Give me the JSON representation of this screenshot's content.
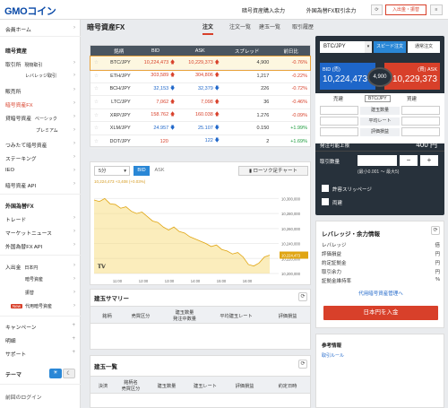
{
  "header": {
    "logo": "GMOコイン",
    "link1": "暗号資産購入余力",
    "link2": "外国為替FX取引余力",
    "signup_label": "入出金・振替"
  },
  "sidebar": {
    "items": [
      {
        "label": "会員ホーム"
      },
      {
        "label": "暗号資産"
      },
      {
        "label": "取引所"
      },
      {
        "label": "現物取引"
      },
      {
        "label": "レバレッジ取引"
      },
      {
        "label": "販売所"
      },
      {
        "label": "暗号資産FX"
      },
      {
        "label": "貸暗号資産"
      },
      {
        "label": "ベーシック"
      },
      {
        "label": "プレミアム"
      },
      {
        "label": "つみたて暗号資産"
      },
      {
        "label": "ステーキング"
      },
      {
        "label": "IEO"
      },
      {
        "label": "暗号資産 API"
      },
      {
        "label": "外国為替FX"
      },
      {
        "label": "トレード"
      },
      {
        "label": "マーケットニュース"
      },
      {
        "label": "外国為替FX API"
      },
      {
        "label": "入出金"
      },
      {
        "label": "日本円"
      },
      {
        "label": "暗号資産"
      },
      {
        "label": "振替"
      },
      {
        "label": "代用暗号資産"
      },
      {
        "label": "キャンペーン"
      },
      {
        "label": "明細"
      },
      {
        "label": "サポート"
      }
    ],
    "new_badge": "New",
    "theme_label": "テーマ",
    "last_login": "前回のログイン"
  },
  "main": {
    "title": "暗号資産FX",
    "tabs": [
      "注文",
      "注文一覧",
      "建玉一覧",
      "取引履歴"
    ],
    "rates": {
      "columns": [
        "銘柄",
        "BID",
        "ASK",
        "スプレッド",
        "前日比"
      ],
      "rows": [
        {
          "symbol": "BTC/JPY",
          "bid": "10,224,473",
          "ask": "10,229,373",
          "bid_dir": "up",
          "ask_dir": "up",
          "spread": "4,900",
          "chg": "-0.76%"
        },
        {
          "symbol": "ETH/JPY",
          "bid": "303,589",
          "ask": "304,806",
          "bid_dir": "up",
          "ask_dir": "up",
          "spread": "1,217",
          "chg": "-0.22%"
        },
        {
          "symbol": "BCH/JPY",
          "bid": "32,153",
          "ask": "32,379",
          "bid_dir": "down",
          "ask_dir": "down",
          "spread": "226",
          "chg": "-0.72%"
        },
        {
          "symbol": "LTC/JPY",
          "bid": "7,062",
          "ask": "7,098",
          "bid_dir": "up",
          "ask_dir": "up",
          "spread": "36",
          "chg": "-0.46%"
        },
        {
          "symbol": "XRP/JPY",
          "bid": "158.762",
          "ask": "160.038",
          "bid_dir": "up",
          "ask_dir": "up",
          "spread": "1.276",
          "chg": "-0.09%"
        },
        {
          "symbol": "XLM/JPY",
          "bid": "24.957",
          "ask": "25.107",
          "bid_dir": "down",
          "ask_dir": "down",
          "spread": "0.150",
          "chg": "+1.99%"
        },
        {
          "symbol": "DOT/JPY",
          "bid": "120",
          "ask": "122",
          "bid_dir": "none",
          "ask_dir": "down",
          "spread": "2",
          "chg": "+1.69%"
        }
      ]
    },
    "chart": {
      "interval": "5分",
      "bid_btn": "BID",
      "ask_btn": "ASK",
      "chart_btn": "ローソク足チャート",
      "ohlc": "10,224,473 +3,408 (+0.03%)",
      "price_tag": "10,224,473"
    },
    "positions_summary": {
      "title": "建玉サマリー",
      "columns": [
        "銘柄",
        "売買区分",
        "建玉数量\n発注中数量",
        "平均建玉レート",
        "評価損益"
      ]
    },
    "positions_list": {
      "title": "建玉一覧",
      "columns": [
        "決済",
        "銘柄名\n売買区分",
        "建玉数量",
        "建玉レート",
        "評価損益",
        "約定日時"
      ]
    }
  },
  "chart_data": {
    "type": "area",
    "x_ticks": [
      "11:00",
      "12:00",
      "13:00",
      "14:00",
      "15:00",
      "16:00"
    ],
    "y_ticks": [
      "10,300,000",
      "10,280,000",
      "10,260,000",
      "10,240,000",
      "10,220,000",
      "10,200,000"
    ],
    "ylim": [
      10200000,
      10310000
    ],
    "values": [
      10298000,
      10296000,
      10300000,
      10293000,
      10292000,
      10287000,
      10289000,
      10283000,
      10280000,
      10282000,
      10276000,
      10270000,
      10268000,
      10262000,
      10258000,
      10262000,
      10256000,
      10254000,
      10249000,
      10246000,
      10243000,
      10240000,
      10236000,
      10238000,
      10232000,
      10230000,
      10226000,
      10228000,
      10222000,
      10212000,
      10210000,
      10214000,
      10222000,
      10224473
    ]
  },
  "order": {
    "pair": "BTC/JPY",
    "speed_label": "スピード注文",
    "normal_label": "通常注文",
    "bid_label": "BID (売)",
    "ask_label": "(買) ASK",
    "bid_price": "10,224,473",
    "ask_price": "10,229,373",
    "spread": "4,900",
    "sell_label": "売建",
    "buy_label": "買建",
    "pair_tag": "BTC/JPY",
    "rows": [
      "建玉数量",
      "平均レート",
      "評価損益"
    ],
    "available_label": "発注可能上限",
    "available_value": "400 円",
    "qty_label": "取引数量",
    "qty_hint": "(最小0.001 ～ 最大5)",
    "slippage_label": "許容スリッページ",
    "settle_label": "両建",
    "minus": "−",
    "plus": "+"
  },
  "leverage": {
    "title": "レバレッジ・余力情報",
    "rows": [
      {
        "label": "レバレッジ",
        "value": "倍"
      },
      {
        "label": "評価損益",
        "value": "円"
      },
      {
        "label": "約定証拠金",
        "value": "円"
      },
      {
        "label": "取引余力",
        "value": "円"
      },
      {
        "label": "証拠金維持率",
        "value": "%"
      }
    ],
    "link": "代用暗号資産管理へ",
    "deposit_btn": "日本円を入金"
  },
  "reference": {
    "title": "参考情報",
    "link": "取引ルール"
  },
  "colors": {
    "accent": "#d8402a",
    "bid_blue": "#1e66c9",
    "order_bg": "#27313b",
    "chart_fill": "#f6d66a"
  }
}
